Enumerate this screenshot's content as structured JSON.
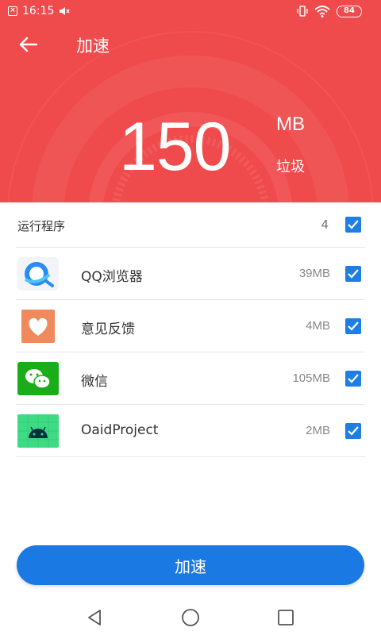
{
  "status_bar": {
    "time": "16:15",
    "battery": "84"
  },
  "header": {
    "title": "加速",
    "amount": "150",
    "unit": "MB",
    "unit_label": "垃圾",
    "bg_color": "#f04b4c"
  },
  "summary": {
    "label": "运行程序",
    "count": "4",
    "checked": true
  },
  "apps": [
    {
      "name": "QQ浏览器",
      "size": "39MB",
      "icon": "qq-browser-icon",
      "checked": true
    },
    {
      "name": "意见反馈",
      "size": "4MB",
      "icon": "feedback-heart-icon",
      "checked": true
    },
    {
      "name": "微信",
      "size": "105MB",
      "icon": "wechat-icon",
      "checked": true
    },
    {
      "name": "OaidProject",
      "size": "2MB",
      "icon": "android-icon",
      "checked": true
    }
  ],
  "button": {
    "label": "加速",
    "color": "#1b79e3"
  },
  "navbar": {
    "items": [
      "back-nav-icon",
      "home-nav-icon",
      "recents-nav-icon"
    ]
  },
  "colors": {
    "checkbox": "#1e7ee6"
  }
}
